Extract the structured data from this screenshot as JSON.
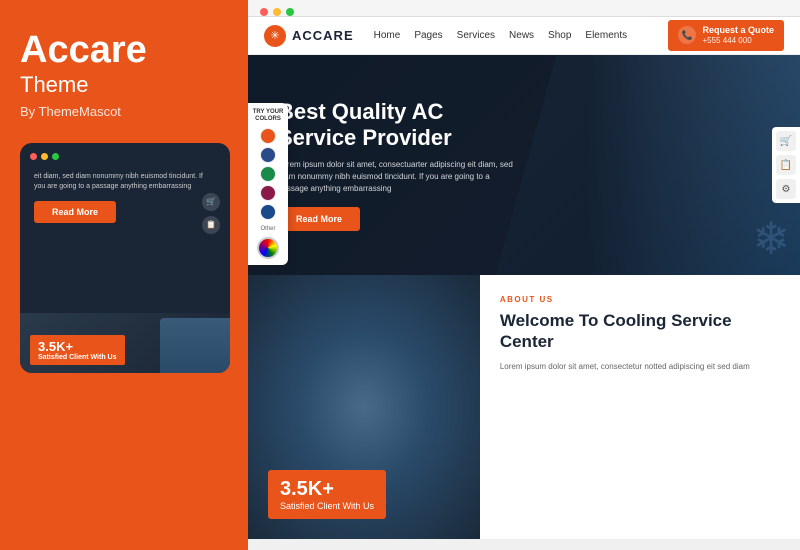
{
  "left_panel": {
    "brand_title": "Accare",
    "brand_sub": "Theme",
    "brand_by": "By ThemeMascot"
  },
  "mobile_mockup": {
    "dots": [
      "red",
      "yellow",
      "green"
    ],
    "text": "eit diam, sed diam nonummy nibh euismod tincidunt. If you are going to a passage anything embarrassing",
    "read_more": "Read More",
    "badge_number": "3.5K+",
    "badge_text": "Satisfied Client With Us"
  },
  "browser": {
    "dots": [
      "red",
      "yellow",
      "green"
    ]
  },
  "nav": {
    "logo_text": "ACCARE",
    "logo_icon": "✳",
    "links": [
      "Home",
      "Pages",
      "Services",
      "News",
      "Shop",
      "Elements"
    ],
    "quote_label": "Request a Quote",
    "quote_phone": "+555 444 000"
  },
  "hero": {
    "title": "Best Quality AC Service Provider",
    "description": "Lorem ipsum dolor sit amet, consectuarter adipiscing eit diam, sed diam nonummy nibh euismod tincidunt. If you are going to a passage anything embarrassing",
    "read_more": "Read More",
    "arrow_left": "‹",
    "arrow_right": "›",
    "snowflake": "❄"
  },
  "color_picker": {
    "try_label": "TRY YOUR",
    "colors_label": "COLORS",
    "colors": [
      "#E8541A",
      "#2a4a8a",
      "#1a8a4a",
      "#8a1a4a",
      "#1a4a8a"
    ],
    "other_label": "Other",
    "icons": [
      "🛒",
      "📋",
      "⚙"
    ]
  },
  "bottom_left": {
    "badge_number": "3.5K+",
    "badge_text": "Satisfied Client With Us"
  },
  "bottom_right": {
    "about_label": "ABOUT US",
    "about_title": "Welcome To Cooling Service Center",
    "about_desc": "Lorem ipsum dolor sit amet, consectetur notted adipiscing eit sed diam"
  }
}
